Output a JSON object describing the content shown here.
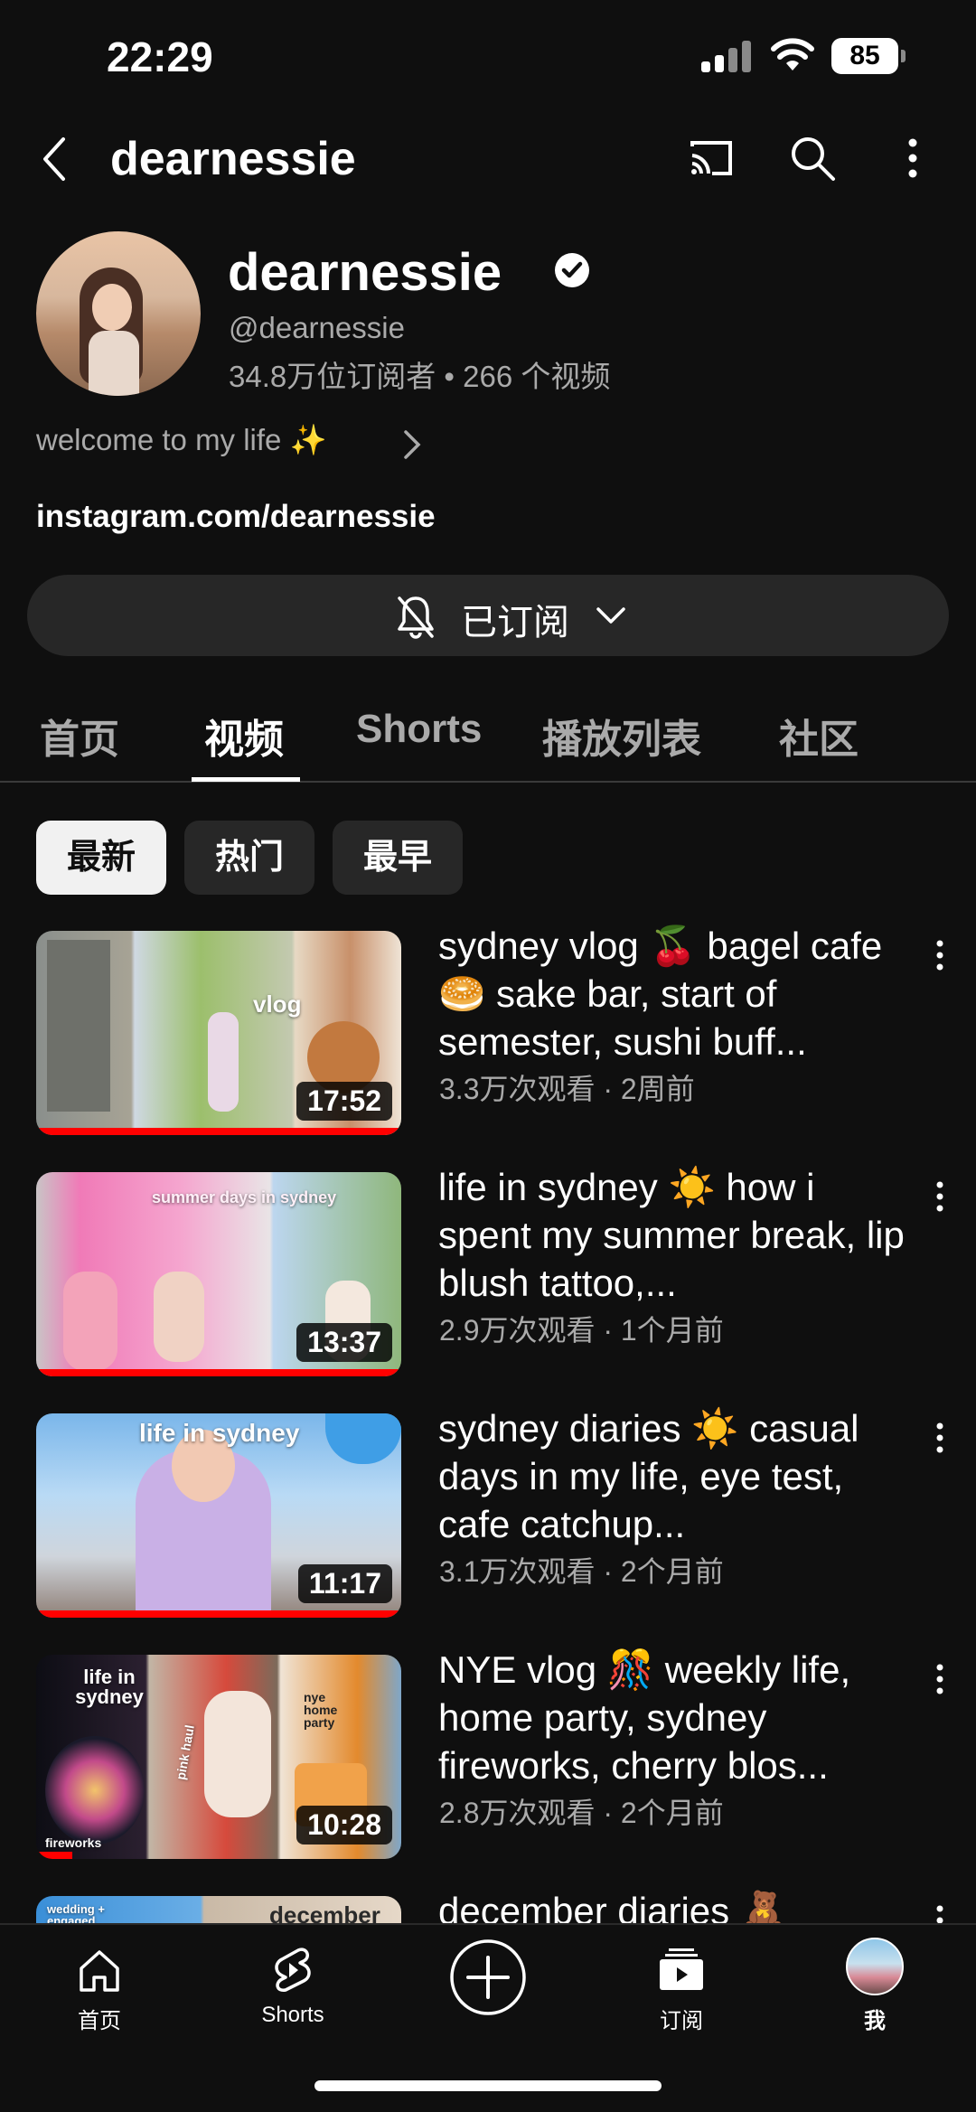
{
  "status_bar": {
    "time": "22:29",
    "battery": "85"
  },
  "app_bar": {
    "title": "dearnessie"
  },
  "channel": {
    "name": "dearnessie",
    "handle": "@dearnessie",
    "stats": "34.8万位订阅者 • 266 个视频",
    "description": "welcome to my life ✨",
    "link": "instagram.com/dearnessie",
    "subscribe_label": "已订阅"
  },
  "tabs": [
    "首页",
    "视频",
    "Shorts",
    "播放列表",
    "社区"
  ],
  "active_tab": "视频",
  "chips": [
    "最新",
    "热门",
    "最早"
  ],
  "active_chip": "最新",
  "videos": [
    {
      "title": "sydney vlog 🍒 bagel cafe 🥯 sake bar, start of semester, sushi buff...",
      "meta": "3.3万次观看 · 2周前",
      "duration": "17:52",
      "thumb_text": "vlog"
    },
    {
      "title": "life in sydney ☀️ how i spent my summer break, lip blush tattoo,...",
      "meta": "2.9万次观看 · 1个月前",
      "duration": "13:37",
      "thumb_text": "summer days in sydney"
    },
    {
      "title": "sydney diaries ☀️ casual days in my life, eye test, cafe catchup...",
      "meta": "3.1万次观看 · 2个月前",
      "duration": "11:17",
      "thumb_text": "life in sydney"
    },
    {
      "title": "NYE vlog 🎊 weekly life, home party, sydney fireworks, cherry blos...",
      "meta": "2.8万次观看 · 2个月前",
      "duration": "10:28",
      "thumb_text": "life in sydney",
      "thumb_text_2": "fireworks",
      "thumb_text_3": "nye home party",
      "thumb_text_4": "pink haul"
    },
    {
      "title": "december diaries 🧸",
      "meta": "",
      "duration": "",
      "thumb_text": "december",
      "thumb_text_2": "wedding + engaged"
    }
  ],
  "bottom_nav": [
    {
      "label": "首页",
      "icon": "home-icon"
    },
    {
      "label": "Shorts",
      "icon": "shorts-icon"
    },
    {
      "label": "",
      "icon": "create-icon"
    },
    {
      "label": "订阅",
      "icon": "subscriptions-icon"
    },
    {
      "label": "我",
      "icon": "profile-avatar"
    }
  ]
}
